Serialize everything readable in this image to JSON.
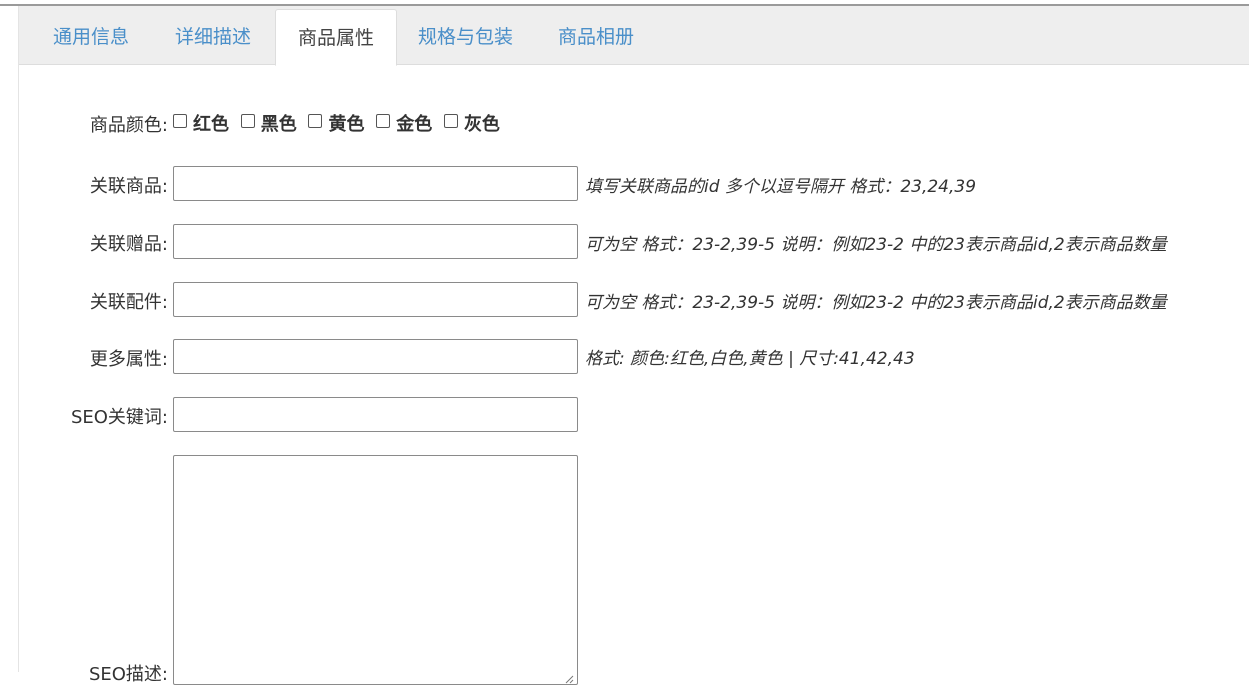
{
  "tabs": [
    {
      "label": "通用信息"
    },
    {
      "label": "详细描述"
    },
    {
      "label": "商品属性"
    },
    {
      "label": "规格与包装"
    },
    {
      "label": "商品相册"
    }
  ],
  "form": {
    "color_label": "商品颜色:",
    "colors": [
      "红色",
      "黑色",
      "黄色",
      "金色",
      "灰色"
    ],
    "related_goods_label": "关联商品:",
    "related_goods_hint": "填写关联商品的id 多个以逗号隔开 格式：23,24,39",
    "gift_label": "关联赠品:",
    "gift_hint": "可为空 格式：23-2,39-5 说明：例如23-2 中的23表示商品id,2表示商品数量",
    "parts_label": "关联配件:",
    "parts_hint": "可为空 格式：23-2,39-5 说明：例如23-2 中的23表示商品id,2表示商品数量",
    "more_attr_label": "更多属性:",
    "more_attr_hint": "格式: 颜色:红色,白色,黄色 | 尺寸:41,42,43",
    "seo_keywords_label": "SEO关键词:",
    "seo_desc_label": "SEO描述:"
  }
}
